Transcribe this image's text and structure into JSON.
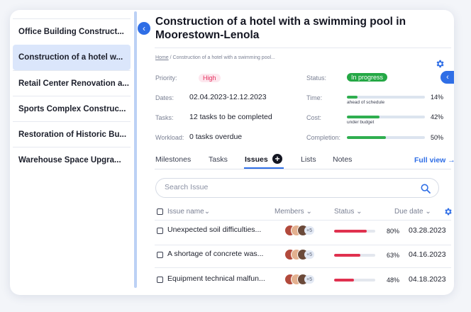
{
  "sidebar": {
    "items": [
      {
        "label": "Office Building Construct...",
        "active": false
      },
      {
        "label": "Construction of a hotel w...",
        "active": true
      },
      {
        "label": "Retail Center Renovation a...",
        "active": false
      },
      {
        "label": "Sports Complex Construc...",
        "active": false
      },
      {
        "label": "Restoration of Historic Bu...",
        "active": false
      },
      {
        "label": "Warehouse Space Upgra...",
        "active": false
      }
    ],
    "collapse_icon": "chevron-left-icon"
  },
  "project": {
    "title": "Construction of a hotel with a swimming pool in Moorestown-Lenola",
    "breadcrumb_home": "Home",
    "breadcrumb_rest": " / Construction of a hotel with a swimming pool...",
    "priority_label": "Priority:",
    "priority_value": "High",
    "dates_label": "Dates:",
    "dates_value": "02.04.2023-12.12.2023",
    "tasks_label": "Tasks:",
    "tasks_value": "12 tasks to be completed",
    "workload_label": "Workload:",
    "workload_value": "0 tasks overdue",
    "status_label": "Status:",
    "status_value": "In progress",
    "time_label": "Time:",
    "time_note": "ahead of schedule",
    "time_pct": "14%",
    "time_progress": 0.14,
    "cost_label": "Cost:",
    "cost_note": "under budget",
    "cost_pct": "42%",
    "cost_progress": 0.42,
    "completion_label": "Completion:",
    "completion_pct": "50%",
    "completion_progress": 0.5
  },
  "tabs": {
    "items": [
      "Milestones",
      "Tasks",
      "Issues",
      "Lists",
      "Notes"
    ],
    "active": "Issues",
    "full_view": "Full view →"
  },
  "search": {
    "placeholder": "Search Issue"
  },
  "table": {
    "col_name": "Issue name",
    "col_members": "Members",
    "col_status": "Status",
    "col_due": "Due date",
    "rows": [
      {
        "name": "Unexpected soil difficulties...",
        "more": "+5",
        "pct": "80%",
        "progress": 0.8,
        "due": "03.28.2023"
      },
      {
        "name": "A shortage of concrete was...",
        "more": "+5",
        "pct": "63%",
        "progress": 0.63,
        "due": "04.16.2023"
      },
      {
        "name": "Equipment technical malfun...",
        "more": "+5",
        "pct": "48%",
        "progress": 0.48,
        "due": "04.18.2023"
      }
    ]
  },
  "colors": {
    "accent": "#2f6ee6",
    "success": "#2fae4f",
    "danger": "#e0314f",
    "priority_high": "#e5305e"
  }
}
